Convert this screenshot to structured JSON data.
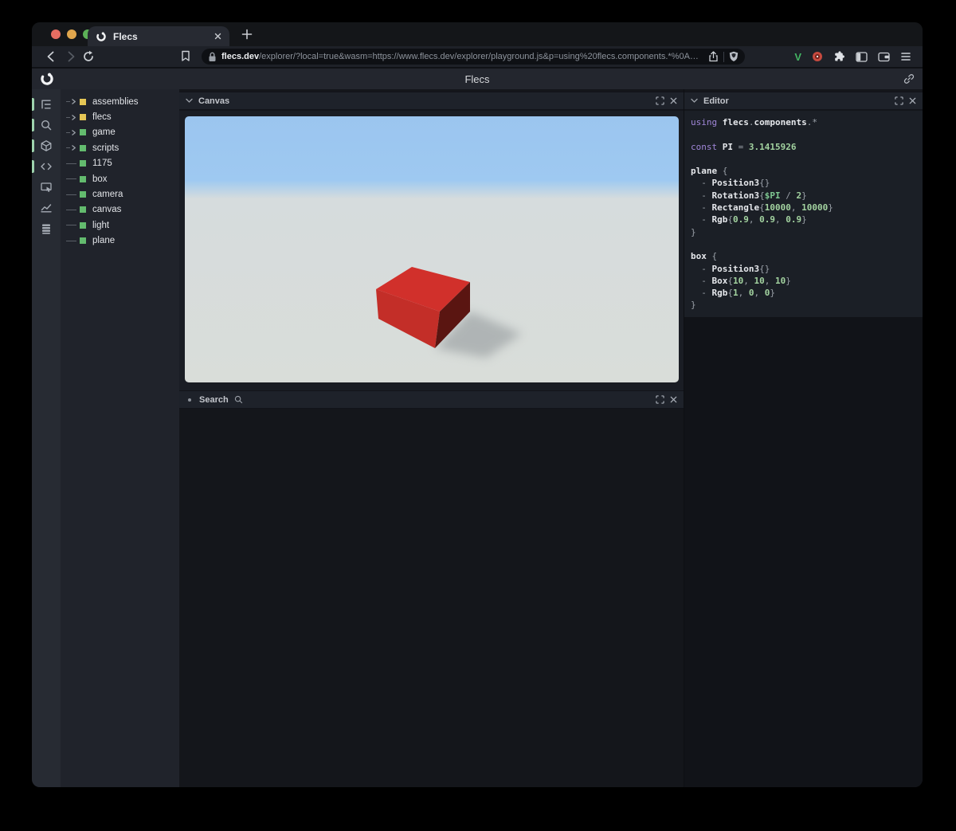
{
  "browser": {
    "tab": {
      "title": "Flecs"
    },
    "url": {
      "domain": "flecs.dev",
      "path": "/explorer/?local=true&wasm=https://www.flecs.dev/explorer/playground.js&p=using%20flecs.components.*%0A…"
    },
    "extensions": {
      "v_label": "V"
    },
    "colors": {
      "traffic_red": "#e56d62",
      "traffic_yellow": "#e0a64d",
      "traffic_green": "#5cb157"
    }
  },
  "app": {
    "title": "Flecs"
  },
  "sidebar": {
    "icons": [
      {
        "name": "entity-tree",
        "active": true
      },
      {
        "name": "query-search",
        "active": true
      },
      {
        "name": "entity-cube",
        "active": true
      },
      {
        "name": "script-code",
        "active": true
      },
      {
        "name": "inspector-window",
        "active": false
      },
      {
        "name": "stats-chart",
        "active": false
      },
      {
        "name": "data-stack",
        "active": false
      }
    ],
    "indicator_color": "#9ed3ae"
  },
  "tree": {
    "items": [
      {
        "label": "assemblies",
        "children": true,
        "color": "#e5c655"
      },
      {
        "label": "flecs",
        "children": true,
        "color": "#e5c655"
      },
      {
        "label": "game",
        "children": true,
        "color": "#63bb6e"
      },
      {
        "label": "scripts",
        "children": true,
        "color": "#63bb6e"
      },
      {
        "label": "1175",
        "children": false,
        "color": "#63bb6e"
      },
      {
        "label": "box",
        "children": false,
        "color": "#63bb6e"
      },
      {
        "label": "camera",
        "children": false,
        "color": "#63bb6e"
      },
      {
        "label": "canvas",
        "children": false,
        "color": "#63bb6e"
      },
      {
        "label": "light",
        "children": false,
        "color": "#63bb6e"
      },
      {
        "label": "plane",
        "children": false,
        "color": "#63bb6e"
      }
    ]
  },
  "canvas_panel": {
    "title": "Canvas"
  },
  "search_panel": {
    "title": "Search"
  },
  "editor_panel": {
    "title": "Editor",
    "code": [
      [
        [
          "kw",
          "using "
        ],
        [
          "id",
          "flecs"
        ],
        [
          "pun",
          "."
        ],
        [
          "id",
          "components"
        ],
        [
          "pun",
          ".*"
        ]
      ],
      [],
      [
        [
          "kw",
          "const "
        ],
        [
          "id",
          "PI"
        ],
        [
          "pun",
          " = "
        ],
        [
          "num",
          "3.1415926"
        ]
      ],
      [],
      [
        [
          "id",
          "plane"
        ],
        [
          "pun",
          " {"
        ]
      ],
      [
        [
          "pun",
          "  - "
        ],
        [
          "id",
          "Position3"
        ],
        [
          "pun",
          "{}"
        ]
      ],
      [
        [
          "pun",
          "  - "
        ],
        [
          "id",
          "Rotation3"
        ],
        [
          "pun",
          "{"
        ],
        [
          "var",
          "$PI"
        ],
        [
          "pun",
          " / "
        ],
        [
          "num",
          "2"
        ],
        [
          "pun",
          "}"
        ]
      ],
      [
        [
          "pun",
          "  - "
        ],
        [
          "id",
          "Rectangle"
        ],
        [
          "pun",
          "{"
        ],
        [
          "num",
          "10000"
        ],
        [
          "pun",
          ", "
        ],
        [
          "num",
          "10000"
        ],
        [
          "pun",
          "}"
        ]
      ],
      [
        [
          "pun",
          "  - "
        ],
        [
          "id",
          "Rgb"
        ],
        [
          "pun",
          "{"
        ],
        [
          "num",
          "0.9"
        ],
        [
          "pun",
          ", "
        ],
        [
          "num",
          "0.9"
        ],
        [
          "pun",
          ", "
        ],
        [
          "num",
          "0.9"
        ],
        [
          "pun",
          "}"
        ]
      ],
      [
        [
          "pun",
          "}"
        ]
      ],
      [],
      [
        [
          "id",
          "box"
        ],
        [
          "pun",
          " {"
        ]
      ],
      [
        [
          "pun",
          "  - "
        ],
        [
          "id",
          "Position3"
        ],
        [
          "pun",
          "{}"
        ]
      ],
      [
        [
          "pun",
          "  - "
        ],
        [
          "id",
          "Box"
        ],
        [
          "pun",
          "{"
        ],
        [
          "num",
          "10"
        ],
        [
          "pun",
          ", "
        ],
        [
          "num",
          "10"
        ],
        [
          "pun",
          ", "
        ],
        [
          "num",
          "10"
        ],
        [
          "pun",
          "}"
        ]
      ],
      [
        [
          "pun",
          "  - "
        ],
        [
          "id",
          "Rgb"
        ],
        [
          "pun",
          "{"
        ],
        [
          "num",
          "1"
        ],
        [
          "pun",
          ", "
        ],
        [
          "num",
          "0"
        ],
        [
          "pun",
          ", "
        ],
        [
          "num",
          "0"
        ],
        [
          "pun",
          "}"
        ]
      ],
      [
        [
          "pun",
          "}"
        ]
      ]
    ]
  },
  "scene": {
    "sky_top": "#9bc5ef",
    "sky_low": "#9ec9f1",
    "ground_high": "#d6dcdd",
    "ground_low": "#d9ddd9",
    "box_top": "#d1302b",
    "box_front": "#c32e28",
    "box_side": "#5a1511",
    "shadow": "#878d91"
  }
}
